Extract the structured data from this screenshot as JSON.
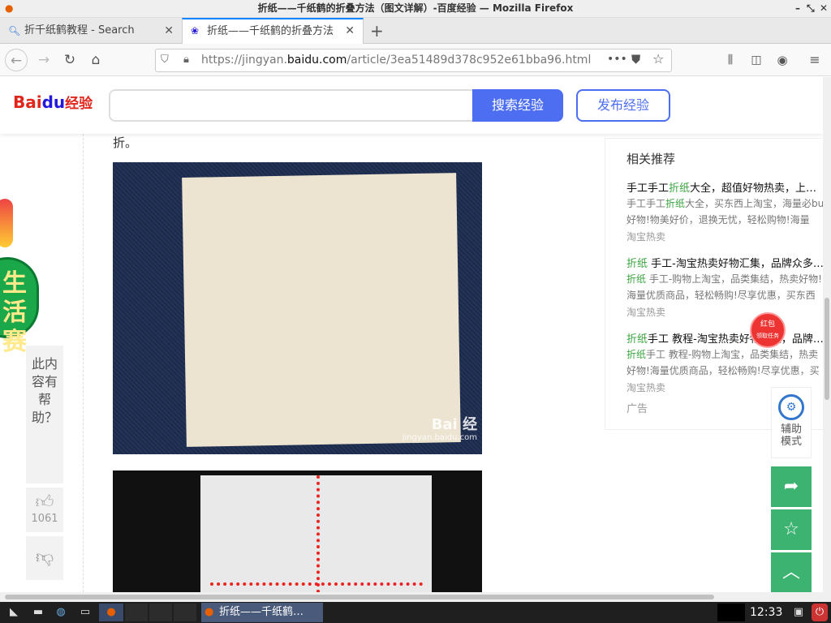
{
  "window": {
    "title": "折纸——千纸鹤的折叠方法（图文详解）-百度经验 — Mozilla Firefox",
    "controls": [
      "–",
      "⤡",
      "✕"
    ]
  },
  "tabs": [
    {
      "label": "折千纸鹤教程 - Search",
      "icon": "search-icon",
      "active": false
    },
    {
      "label": "折纸——千纸鹤的折叠方法",
      "icon": "paw-icon",
      "active": true
    }
  ],
  "new_tab_label": "+",
  "url": {
    "prefix": "https://jingyan.",
    "domain": "baidu.com",
    "suffix": "/article/3ea51489d378c952e61bba96.html"
  },
  "header": {
    "logo": "Bai",
    "logo_paw": "du",
    "logo_suffix": "经验",
    "search_placeholder": "",
    "search_button": "搜索经验",
    "publish_button": "发布经验"
  },
  "article": {
    "text_fragment": "折。",
    "watermark_main": "Bai 经",
    "watermark_sub": "jingyan.baidu.com"
  },
  "promo": {
    "line1": "生活",
    "line2": "赛"
  },
  "feedback": {
    "helpful_text": "此内容有帮助？",
    "like_count": "1061"
  },
  "related": {
    "title": "相关推荐",
    "items": [
      {
        "title_plain": "手工手工",
        "title_green": "折纸",
        "title_rest": "大全，超值好物热卖，上淘…",
        "desc_plain": "手工手工",
        "desc_green": "折纸",
        "desc_rest": "大全，买东西上淘宝，海量必bu好物!物美好价，退换无忧，轻松购物!海量商…",
        "source": "淘宝热卖"
      },
      {
        "title_plain": "",
        "title_green": "折纸",
        "title_rest": " 手工-淘宝热卖好物汇集，品牌众多…",
        "desc_plain": "",
        "desc_green": "折纸",
        "desc_rest": " 手工-购物上淘宝，品类集结，热卖好物!海量优质商品，轻松畅购!尽享优惠，买东西上…",
        "source": "淘宝热卖"
      },
      {
        "title_plain": "",
        "title_green": "折纸",
        "title_rest": "手工 教程-淘宝热卖好物汇集，品牌…",
        "desc_plain": "",
        "desc_green": "折纸",
        "desc_rest": "手工 教程-购物上淘宝，品类集结，热卖好物!海量优质商品，轻松畅购!尽享优惠，买东…",
        "source": "淘宝热卖"
      }
    ],
    "ad_label": "广告"
  },
  "redpacket": {
    "line1": "红包",
    "line2": "领取任务"
  },
  "side_tools": {
    "assist_label": "辅助模式"
  },
  "taskbar": {
    "window_label": "折纸——千纸鹤…",
    "clock": "12:33"
  },
  "colors": {
    "accent": "#4e6ef2",
    "highlight_green": "#3aa540",
    "side_button": "#3cb371",
    "firefox_tab_accent": "#0a84ff"
  }
}
